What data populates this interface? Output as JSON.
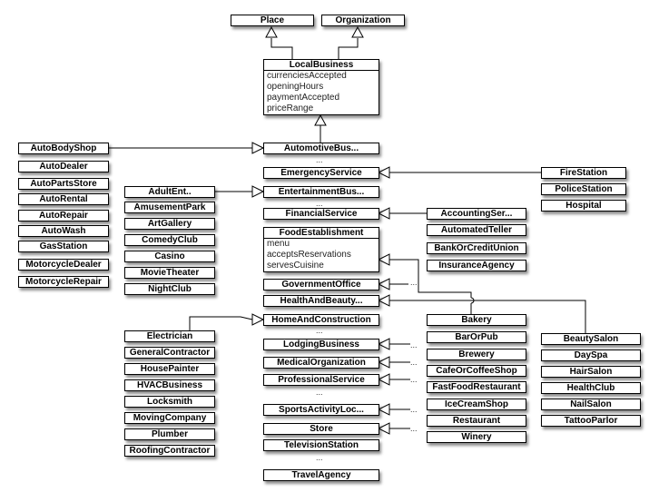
{
  "top": {
    "place": "Place",
    "organization": "Organization"
  },
  "local_business": {
    "name": "LocalBusiness",
    "attributes": [
      "currenciesAccepted",
      "openingHours",
      "paymentAccepted",
      "priceRange"
    ]
  },
  "food": {
    "name": "FoodEstablishment",
    "attributes": [
      "menu",
      "acceptsReservations",
      "servesCuisine"
    ]
  },
  "ellipsis": "...",
  "main_column": [
    "AutomotiveBus...",
    "EmergencyService",
    "EntertainmentBus...",
    "FinancialService",
    "GovernmentOffice",
    "HealthAndBeauty...",
    "HomeAndConstruction",
    "LodgingBusiness",
    "MedicalOrganization",
    "ProfessionalService",
    "SportsActivityLoc...",
    "Store",
    "TelevisionStation",
    "TravelAgency"
  ],
  "automotive": [
    "AutoBodyShop",
    "AutoDealer",
    "AutoPartsStore",
    "AutoRental",
    "AutoRepair",
    "AutoWash",
    "GasStation",
    "MotorcycleDealer",
    "MotorcycleRepair"
  ],
  "entertainment": [
    "AdultEnt..",
    "AmusementPark",
    "ArtGallery",
    "ComedyClub",
    "Casino",
    "MovieTheater",
    "NightClub"
  ],
  "home": [
    "Electrician",
    "GeneralContractor",
    "HousePainter",
    "HVACBusiness",
    "Locksmith",
    "MovingCompany",
    "Plumber",
    "RoofingContractor"
  ],
  "financial": [
    "AccountingSer...",
    "AutomatedTeller",
    "BankOrCreditUnion",
    "InsuranceAgency"
  ],
  "food_types": [
    "Bakery",
    "BarOrPub",
    "Brewery",
    "CafeOrCoffeeShop",
    "FastFoodRestaurant",
    "IceCreamShop",
    "Restaurant",
    "Winery"
  ],
  "emergency": [
    "FireStation",
    "PoliceStation",
    "Hospital"
  ],
  "health": [
    "BeautySalon",
    "DaySpa",
    "HairSalon",
    "HealthClub",
    "NailSalon",
    "TattooParlor"
  ]
}
